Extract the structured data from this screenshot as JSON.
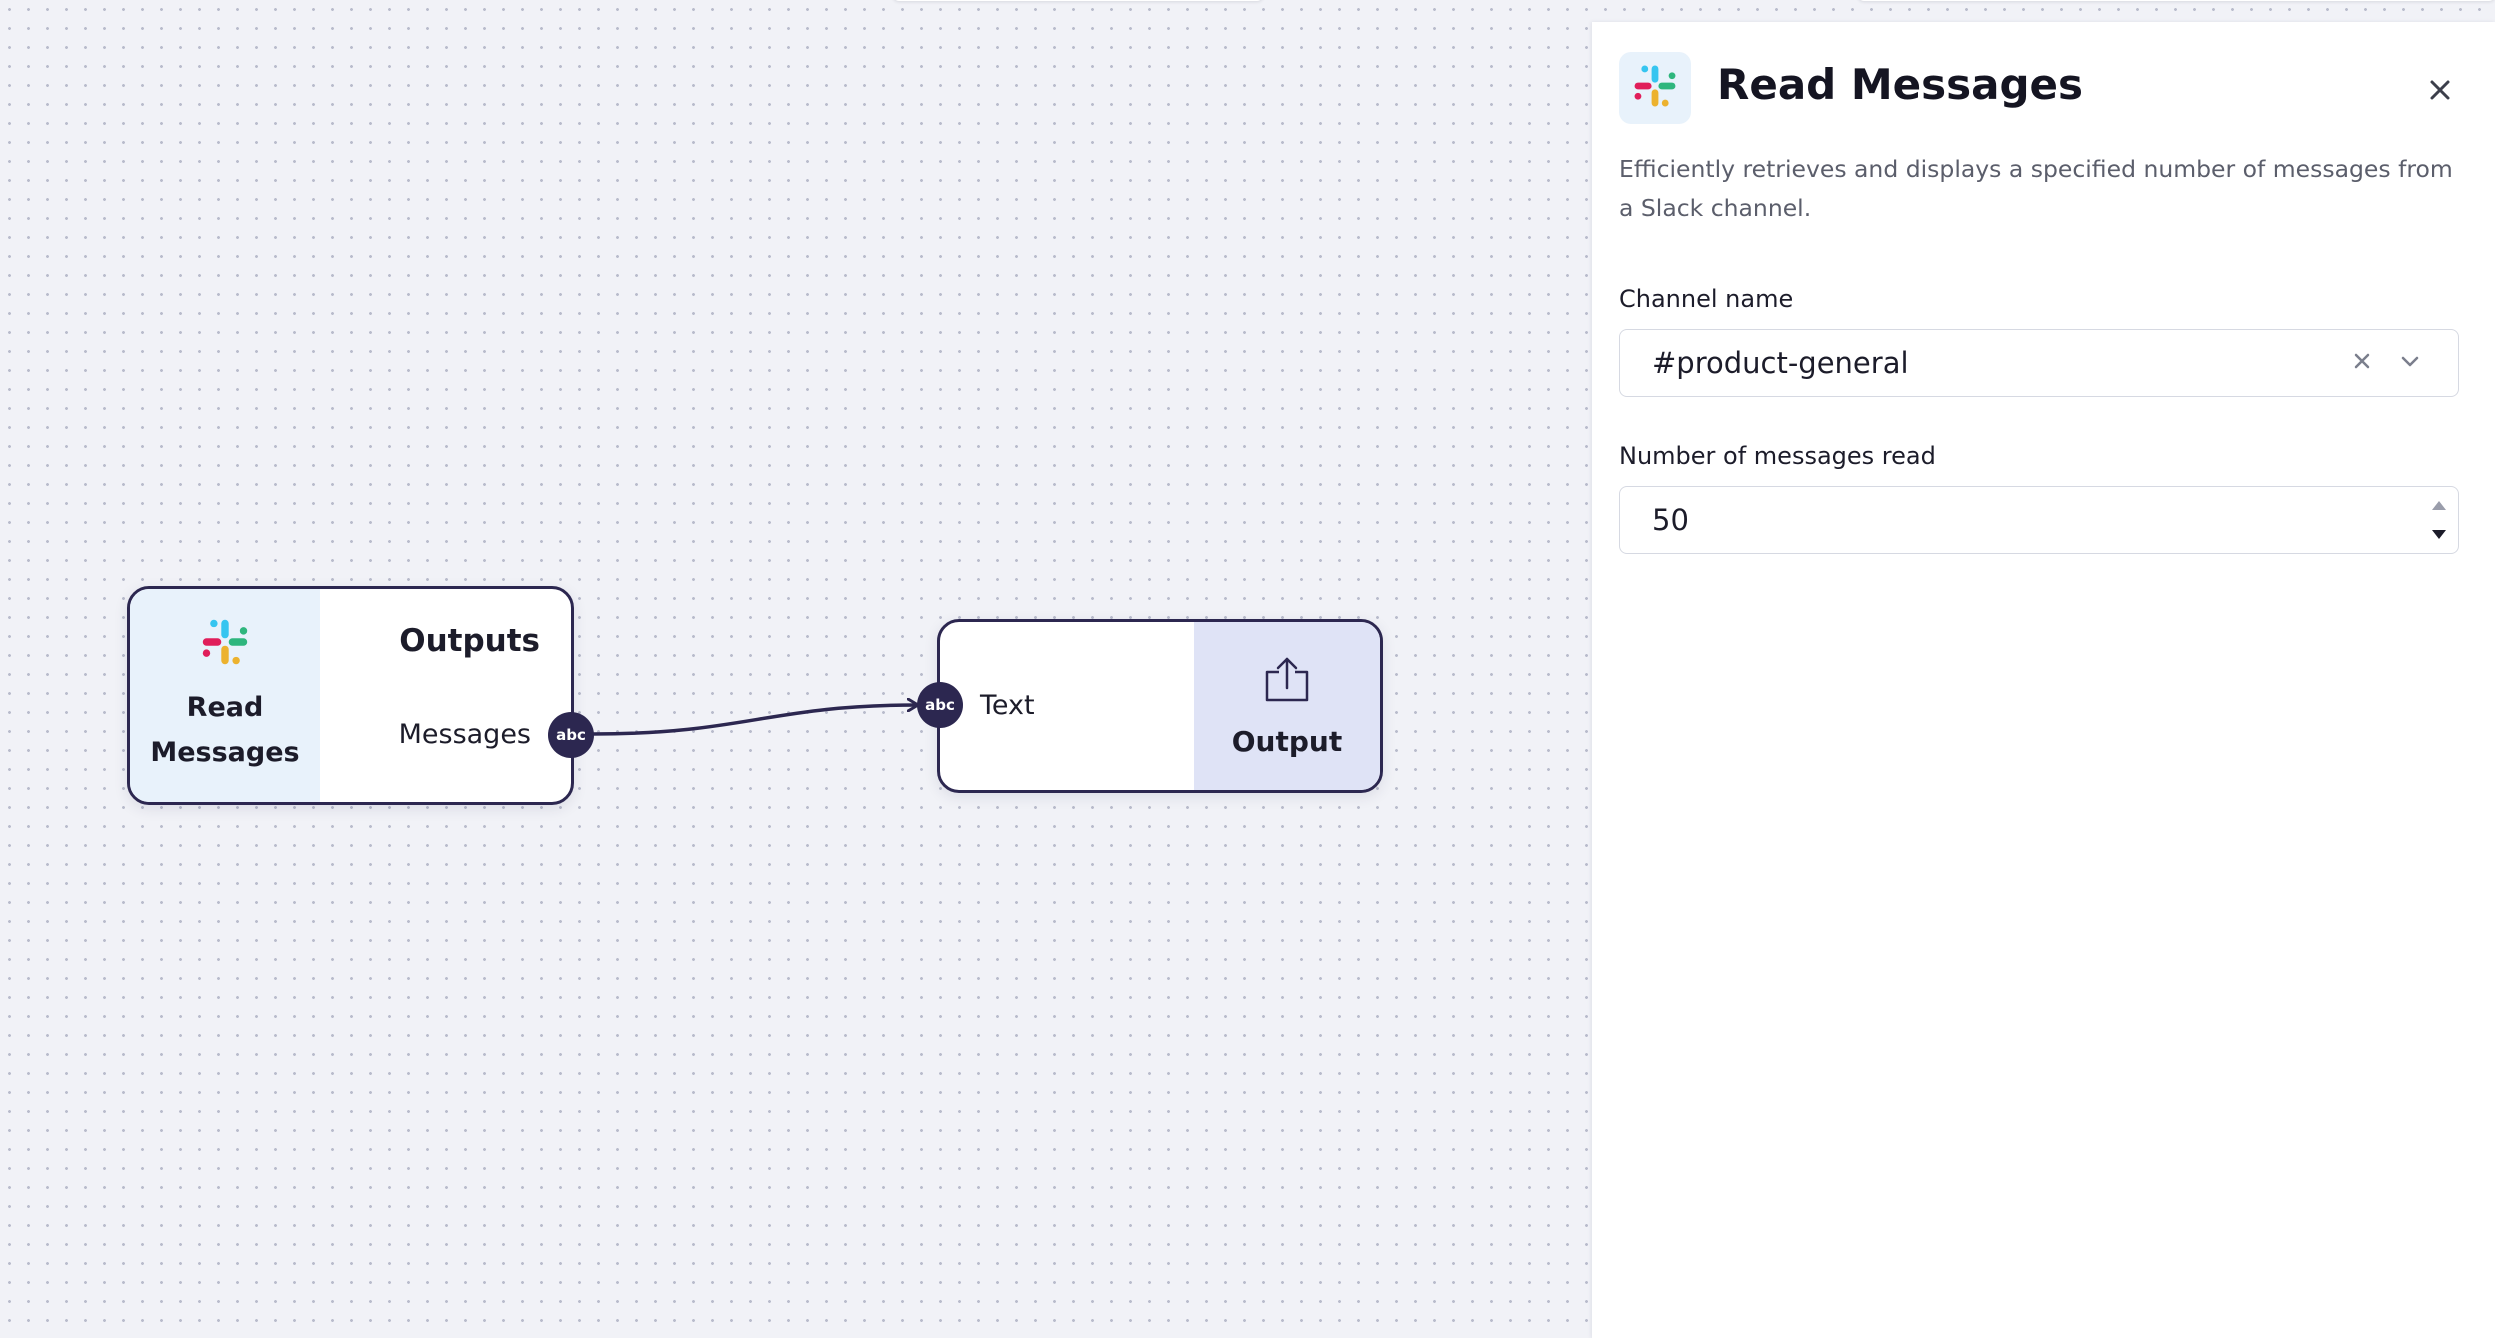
{
  "canvas": {
    "nodes": {
      "read_messages": {
        "tool_name": "Read Messages",
        "tool_icon": "slack-icon",
        "outputs_title": "Outputs",
        "output_port": {
          "label": "Messages",
          "type": "abc"
        }
      },
      "output": {
        "input_port": {
          "label": "Text",
          "type": "abc"
        },
        "title": "Output",
        "icon": "export-icon"
      }
    },
    "edge": {
      "from": "Messages",
      "to": "Text"
    }
  },
  "panel": {
    "icon": "slack-icon",
    "title": "Read Messages",
    "close_icon": "close-icon",
    "description": "Efficiently retrieves and displays a specified number of messages from a Slack channel.",
    "channel": {
      "label": "Channel name",
      "value": "#product-general"
    },
    "message_count": {
      "label": "Number of messages read",
      "value": "50"
    }
  },
  "colors": {
    "canvas_bg": "#f1f2f7",
    "node_border": "#2c2750",
    "tool_panel_bg": "#e8f2fb",
    "output_panel_bg": "#dfe3f6",
    "slack_blue": "#36C5F0",
    "slack_green": "#2EB67D",
    "slack_yellow": "#ECB22E",
    "slack_red": "#E01E5A"
  }
}
